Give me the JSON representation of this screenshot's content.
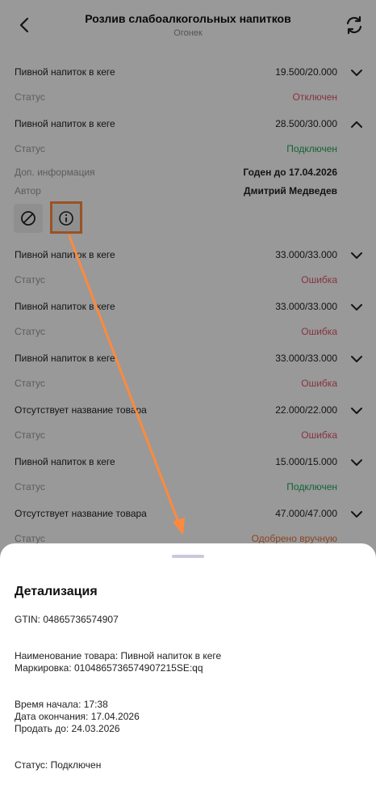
{
  "header": {
    "title": "Розлив слабоалкогольных напитков",
    "subtitle": "Огонек"
  },
  "colors": {
    "status_disabled": "#e0556a",
    "status_connected": "#22a65a",
    "status_error": "#e0556a",
    "status_manual": "#e8743a",
    "highlight": "#ff8a3c"
  },
  "items": [
    {
      "name": "Пивной напиток в кеге",
      "volume": "19.500/20.000",
      "status_label": "Статус",
      "status": "Отключен",
      "expanded": false
    },
    {
      "name": "Пивной напиток в кеге",
      "volume": "28.500/30.000",
      "status_label": "Статус",
      "status": "Подключен",
      "expanded": true,
      "extra_label": "Доп. информация",
      "extra_value": "Годен до 17.04.2026",
      "author_label": "Автор",
      "author_value": "Дмитрий Медведев"
    },
    {
      "name": "Пивной напиток в кеге",
      "volume": "33.000/33.000",
      "status_label": "Статус",
      "status": "Ошибка",
      "expanded": false
    },
    {
      "name": "Пивной напиток в кеге",
      "volume": "33.000/33.000",
      "status_label": "Статус",
      "status": "Ошибка",
      "expanded": false
    },
    {
      "name": "Пивной напиток в кеге",
      "volume": "33.000/33.000",
      "status_label": "Статус",
      "status": "Ошибка",
      "expanded": false
    },
    {
      "name": "Отсутствует название товара",
      "volume": "22.000/22.000",
      "status_label": "Статус",
      "status": "Ошибка",
      "expanded": false
    },
    {
      "name": "Пивной напиток в кеге",
      "volume": "15.000/15.000",
      "status_label": "Статус",
      "status": "Подключен",
      "expanded": false
    },
    {
      "name": "Отсутствует название товара",
      "volume": "47.000/47.000",
      "status_label": "Статус",
      "status": "Одобрено вручную",
      "expanded": false
    }
  ],
  "sheet": {
    "title": "Детализация",
    "gtin": "GTIN: 04865736574907",
    "product": "Наименование товара: Пивной напиток в кеге",
    "marking": "Маркировка: 0104865736574907215SE:qq",
    "start_time": "Время начала: 17:38",
    "end_date": "Дата окончания: 17.04.2026",
    "sell_by": "Продать до: 24.03.2026",
    "status": "Статус: Подключен"
  }
}
